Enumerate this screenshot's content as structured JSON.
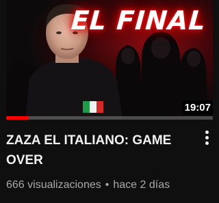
{
  "video": {
    "thumbnail_text": "EL FINAL",
    "duration": "19:07",
    "watch_progress": 0.11,
    "title": "ZAZA EL ITALIANO: GAME OVER",
    "views": "666 visualizaciones",
    "separator": "•",
    "age": "hace 2 días"
  },
  "icons": {
    "menu": "more-vert-icon",
    "flag": "italy-flag-icon"
  },
  "colors": {
    "background": "#0f0f0f",
    "title": "#f1f1f1",
    "meta": "#aaaaaa",
    "progress": "#ff0000",
    "thumb_glow": "#ff1a1a"
  }
}
